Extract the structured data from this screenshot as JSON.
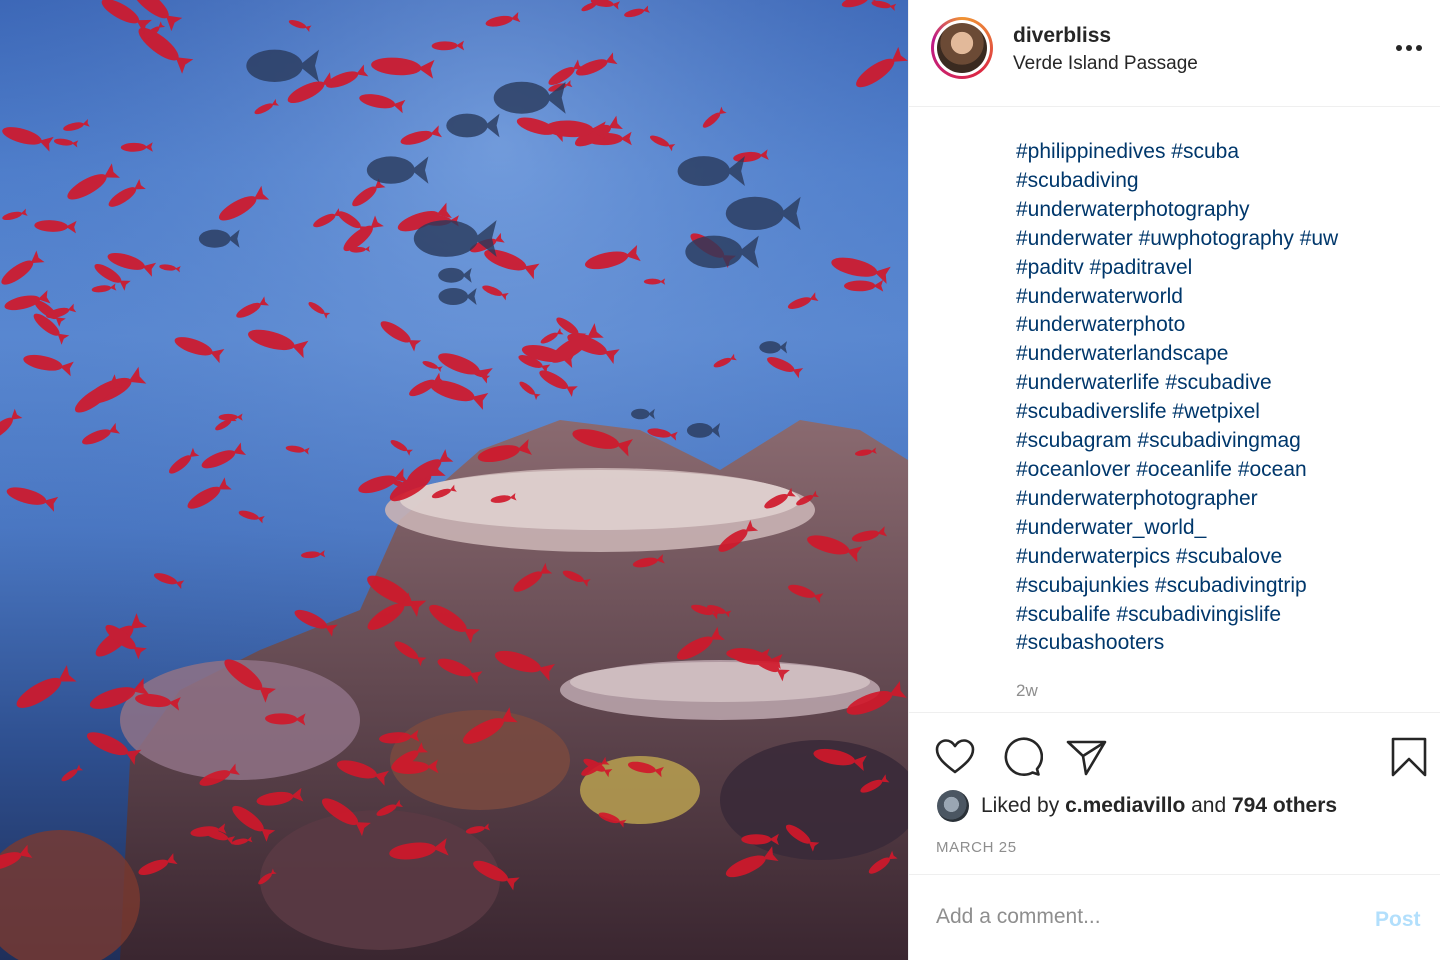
{
  "post": {
    "username": "diverbliss",
    "location": "Verde Island Passage",
    "more_icon": "ellipsis-icon",
    "caption_lines": [
      "#philippinedives #scuba",
      "#scubadiving",
      "#underwaterphotography",
      "#underwater #uwphotography #uw",
      "#paditv #paditravel",
      "#underwaterworld",
      "#underwaterphoto",
      "#underwaterlandscape",
      "#underwaterlife #scubadive",
      "#scubadiverslife #wetpixel",
      "#scubagram #scubadivingmag",
      "#oceanlover #oceanlife #ocean",
      "#underwaterphotographer",
      "#underwater_world_",
      "#underwaterpics #scubalove",
      "#scubajunkies #scubadivingtrip",
      "#scubalife #scubadivingislife",
      "#scubashooters"
    ],
    "time_ago": "2w",
    "likes": {
      "prefix": "Liked by ",
      "user": "c.mediavillo",
      "middle": " and ",
      "others": "794 others"
    },
    "date": "MARCH 25",
    "comment": {
      "placeholder": "Add a comment...",
      "post_label": "Post"
    },
    "hashtag_color": "#00376b",
    "icons": [
      "heart-icon",
      "comment-icon",
      "share-icon",
      "bookmark-icon"
    ]
  }
}
